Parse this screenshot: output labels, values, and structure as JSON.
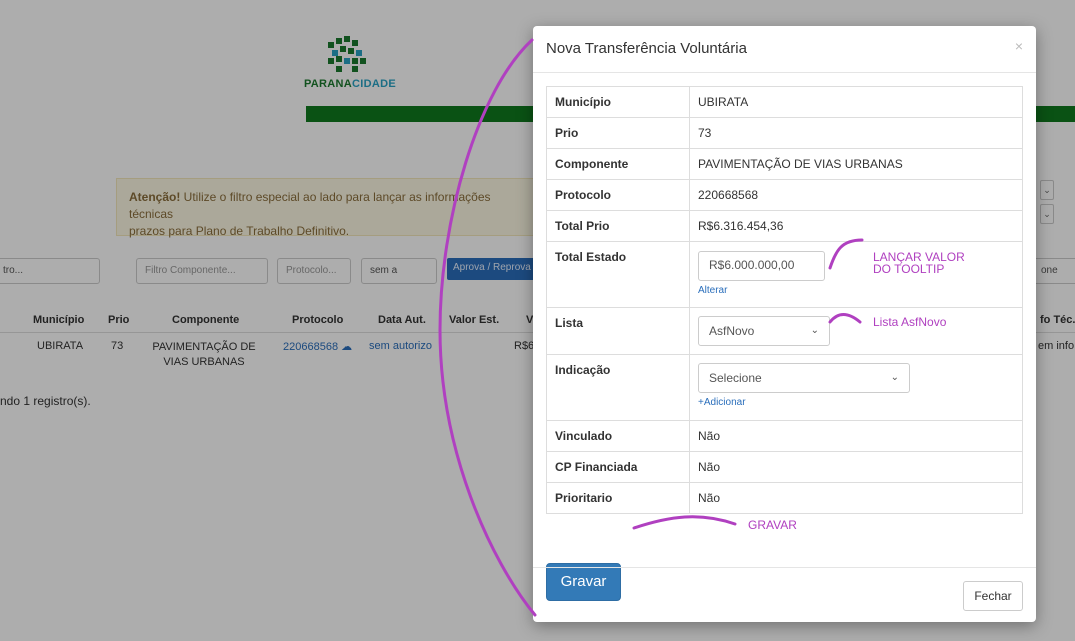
{
  "logo": {
    "part1": "PARANA",
    "part2": "CIDADE"
  },
  "alert": {
    "strong": "Atenção!",
    "line1": " Utilize o filtro especial ao lado para lançar as informações técnicas",
    "line2": "prazos para Plano de Trabalho Definitivo."
  },
  "filters": {
    "f1": "tro...",
    "componente_placeholder": "Filtro Componente...",
    "protocolo_placeholder": "Protocolo...",
    "sema": "sem a",
    "aprova_btn": "Aprova / Reprova P",
    "right": "one"
  },
  "table": {
    "headers": [
      "Município",
      "Prio",
      "Componente",
      "Protocolo",
      "Data Aut.",
      "Valor Est.",
      "V",
      "fo Téc."
    ],
    "row": {
      "municipio": "UBIRATA",
      "prio": "73",
      "componente": "PAVIMENTAÇÃO DE VIAS URBANAS",
      "protocolo": "220668568",
      "data_aut": "sem autorizo",
      "valor": "R$6",
      "info": "em info"
    },
    "found": "ndo 1 registro(s)."
  },
  "modal": {
    "title": "Nova Transferência Voluntária",
    "close": "×",
    "rows": [
      {
        "key": "Município",
        "value": "UBIRATA"
      },
      {
        "key": "Prio",
        "value": "73"
      },
      {
        "key": "Componente",
        "value": "PAVIMENTAÇÃO DE VIAS URBANAS"
      },
      {
        "key": "Protocolo",
        "value": "220668568"
      },
      {
        "key": "Total Prio",
        "value": "R$6.316.454,36"
      }
    ],
    "total_estado": {
      "key": "Total Estado",
      "value": "R$6.000.000,00",
      "link": "Alterar"
    },
    "lista": {
      "key": "Lista",
      "selected": "AsfNovo"
    },
    "indicacao": {
      "key": "Indicação",
      "selected": "Selecione",
      "link": "+Adicionar"
    },
    "rows2": [
      {
        "key": "Vinculado",
        "value": "Não"
      },
      {
        "key": "CP Financiada",
        "value": "Não"
      },
      {
        "key": "Prioritario",
        "value": "Não"
      }
    ],
    "gravar": "Gravar",
    "fechar": "Fechar"
  },
  "annotations": {
    "lancar": "LANÇAR VALOR\nDO TOOLTIP",
    "lista": "Lista AsfNovo",
    "gravar": "GRAVAR",
    "color": "#b040c0"
  }
}
